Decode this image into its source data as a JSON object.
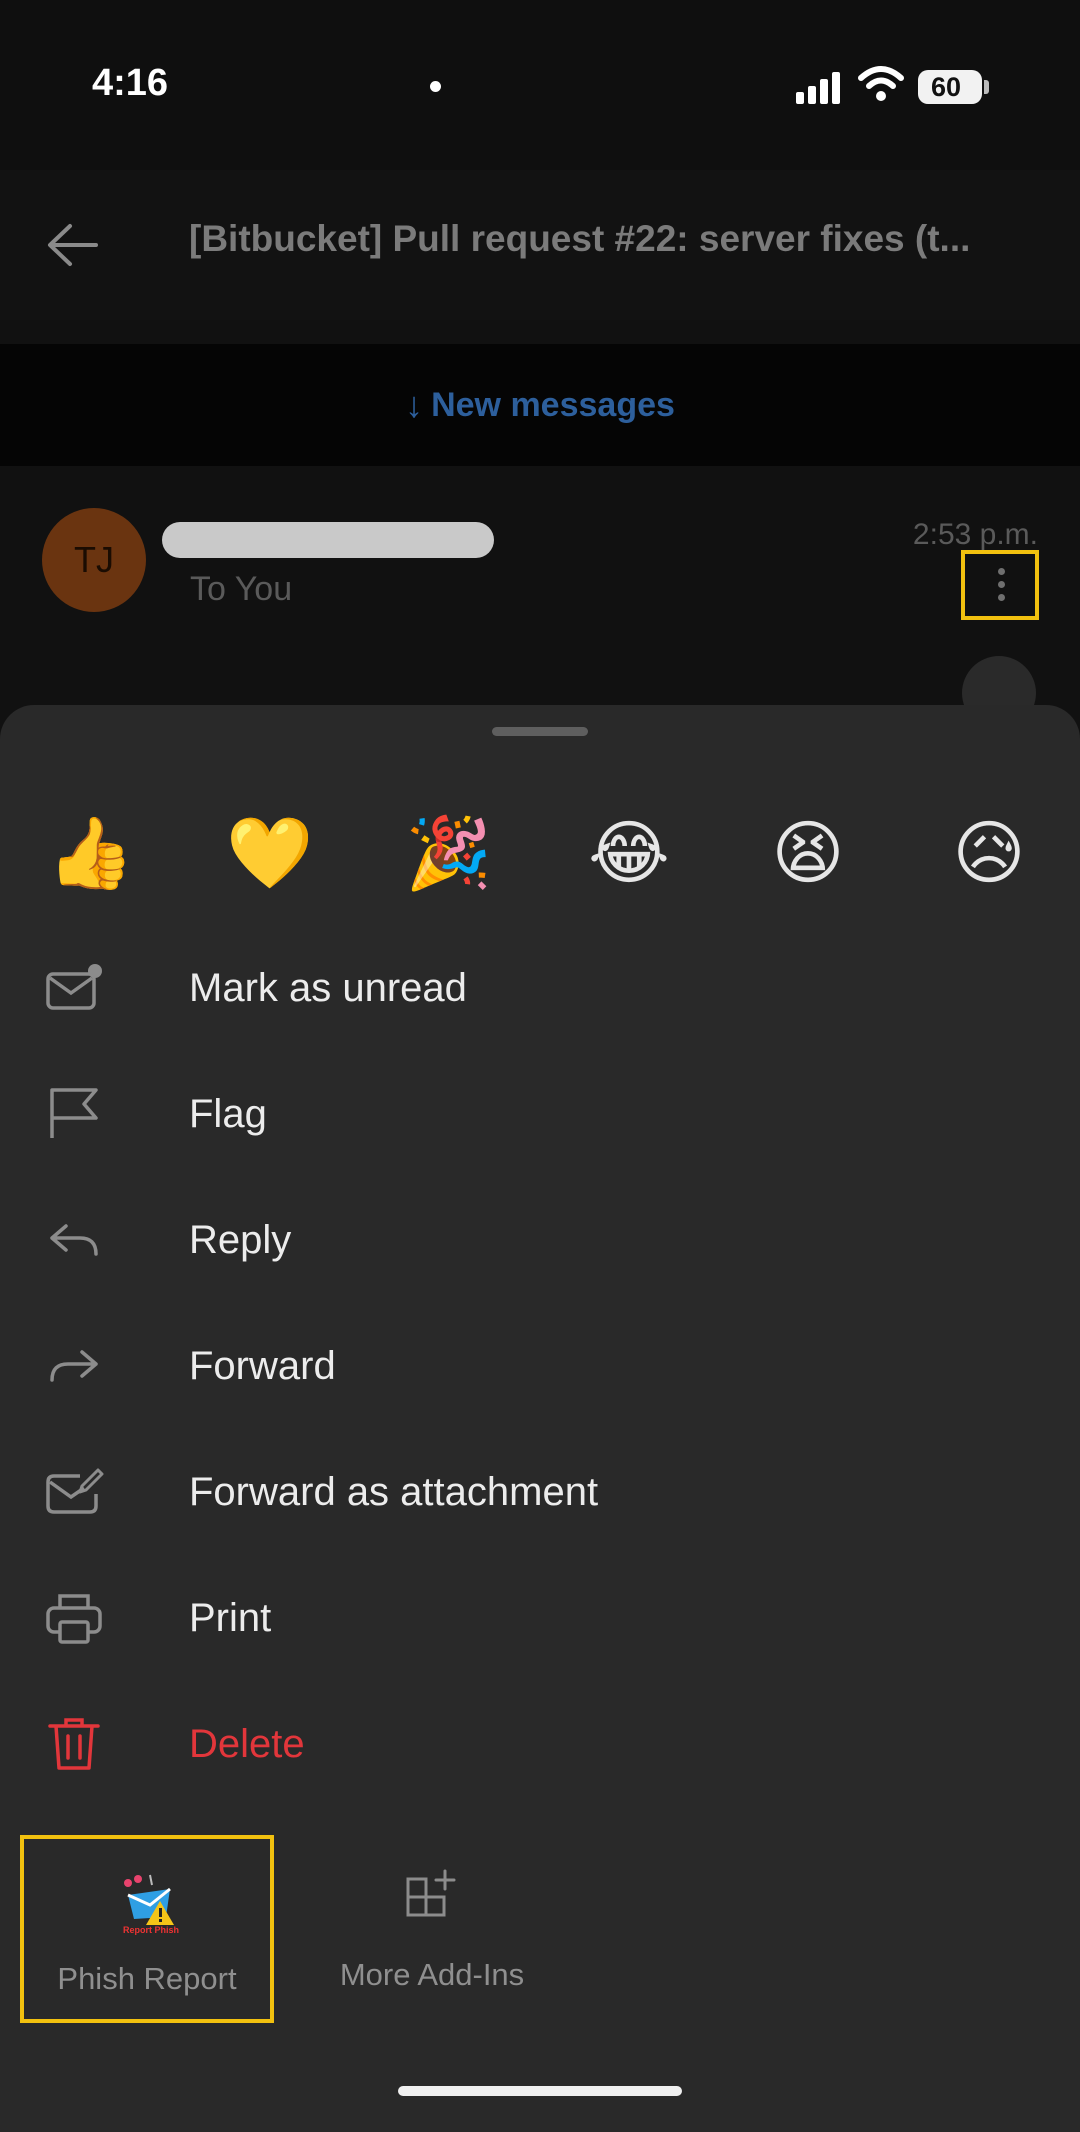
{
  "status_bar": {
    "time": "4:16",
    "battery": "60"
  },
  "header": {
    "title": "[Bitbucket] Pull request #22: server fixes (t..."
  },
  "new_messages": {
    "arrow": "↓",
    "label": "New messages"
  },
  "message": {
    "avatar_initials": "TJ",
    "recipient": "To You",
    "time": "2:53 p.m."
  },
  "reactions": [
    "👍",
    "💛",
    "🎉",
    "😂",
    "😫",
    "😥"
  ],
  "menu": {
    "items": [
      {
        "label": "Mark as unread",
        "icon": "mail-unread-icon"
      },
      {
        "label": "Flag",
        "icon": "flag-icon"
      },
      {
        "label": "Reply",
        "icon": "reply-icon"
      },
      {
        "label": "Forward",
        "icon": "forward-icon"
      },
      {
        "label": "Forward as attachment",
        "icon": "forward-attachment-icon"
      },
      {
        "label": "Print",
        "icon": "printer-icon"
      },
      {
        "label": "Delete",
        "icon": "trash-icon"
      }
    ]
  },
  "addins": {
    "phish": {
      "label": "Phish Report",
      "logo_text": "Report Phish"
    },
    "more": {
      "label": "More Add-Ins"
    }
  },
  "colors": {
    "highlight": "#f2c10f",
    "danger": "#e2363b",
    "link": "#2d5f9c",
    "avatar": "#6a3410"
  }
}
